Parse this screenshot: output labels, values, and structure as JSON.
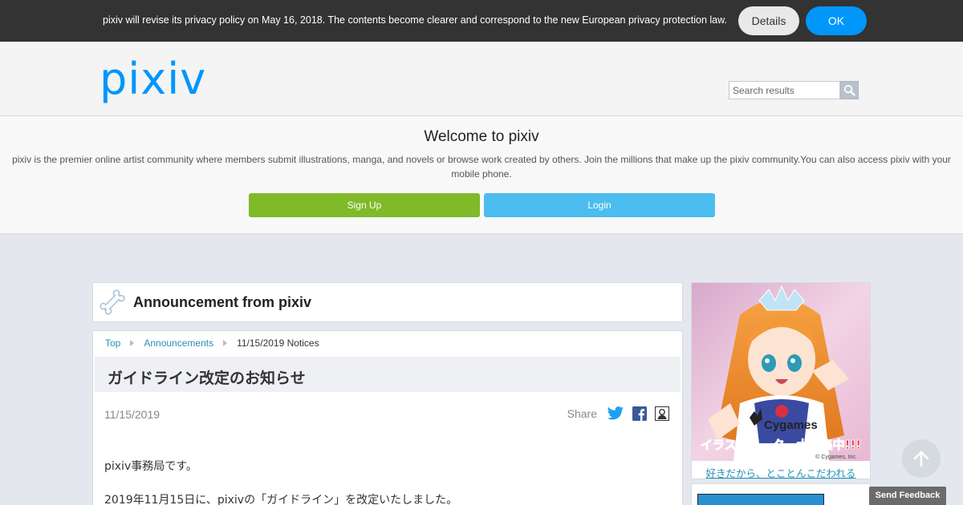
{
  "privacy_bar": {
    "message": "pixiv will revise its privacy policy on May 16, 2018. The contents become clearer and correspond to the new European privacy protection law.",
    "details_label": "Details",
    "ok_label": "OK"
  },
  "header": {
    "logo_text": "pixiv",
    "search_placeholder": "Search results"
  },
  "welcome": {
    "title": "Welcome to pixiv",
    "description": "pixiv is the premier online artist community where members submit illustrations, manga, and novels or browse work created by others. Join the millions that make up the pixiv community.You can also access pixiv with your mobile phone.",
    "signup_label": "Sign Up",
    "login_label": "Login"
  },
  "announcement": {
    "title": "Announcement from pixiv"
  },
  "breadcrumb": {
    "items": [
      "Top",
      "Announcements",
      "11/15/2019 Notices"
    ]
  },
  "article": {
    "heading": "ガイドライン改定のお知らせ",
    "date": "11/15/2019",
    "share_label": "Share",
    "paragraphs": [
      "pixiv事務局です。",
      "2019年11月15日に、pixivの「ガイドライン」を改定いたしました。"
    ]
  },
  "sidebar": {
    "ad_brand": "Cygames",
    "ad_headline": "イラストレーター大募集中!!!",
    "ad_copyright": "© Cygames, Inc.",
    "ad_caption": "好きだから、とことんこだわれる"
  },
  "feedback_label": "Send Feedback",
  "colors": {
    "pixiv_blue": "#0096fa",
    "signup_green": "#7fba29",
    "login_blue": "#4bbdee",
    "link": "#258fb8"
  }
}
